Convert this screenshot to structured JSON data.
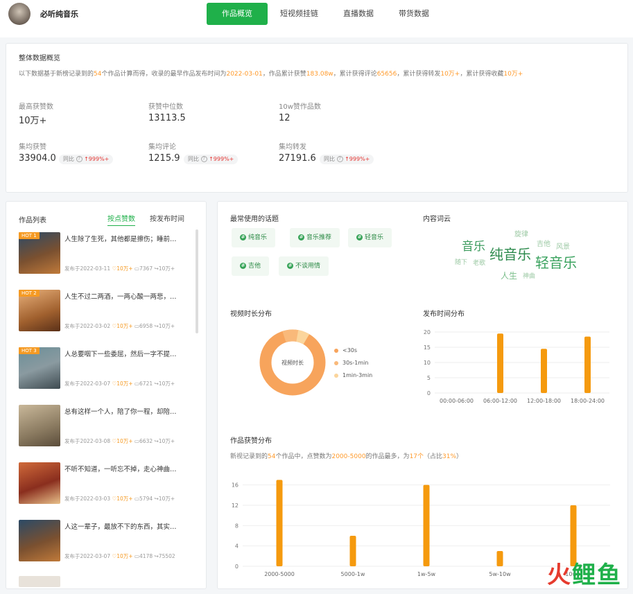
{
  "header": {
    "channel_name": "必听纯音乐",
    "tabs": [
      {
        "label": "作品概览",
        "active": true
      },
      {
        "label": "短视频挂链",
        "active": false
      },
      {
        "label": "直播数据",
        "active": false
      },
      {
        "label": "带货数据",
        "active": false
      }
    ]
  },
  "overview": {
    "title": "整体数据概览",
    "desc": {
      "p1": "以下数据基于新榜记录到的",
      "count": "54",
      "p2": "个作品计算而得，收录的最早作品发布时间为",
      "date": "2022-03-01",
      "p3": "，作品累计获赞",
      "likes": "183.08w",
      "p4": "，累计获得评论",
      "comments": "65656",
      "p5": "，累计获得转发",
      "shares": "10万+",
      "p6": "，累计获得收藏",
      "favs": "10万+"
    },
    "metrics": [
      {
        "label": "最高获赞数",
        "value": "10万+"
      },
      {
        "label": "获赞中位数",
        "value": "13113.5"
      },
      {
        "label": "10w赞作品数",
        "value": "12"
      },
      {
        "label": "集均获赞",
        "value": "33904.0",
        "compare": "同比",
        "change": "999%+"
      },
      {
        "label": "集均评论",
        "value": "1215.9",
        "compare": "同比",
        "change": "999%+"
      },
      {
        "label": "集均转发",
        "value": "27191.6",
        "compare": "同比",
        "change": "999%+"
      }
    ]
  },
  "works": {
    "title": "作品列表",
    "sort_likes": "按点赞数",
    "sort_time": "按发布时间",
    "items": [
      {
        "hot": "HOT 1",
        "title": "人生除了生死，其他都是擦伤；睡前…",
        "date": "发布于2022-03-11",
        "likes": "10万+",
        "comments": "7367",
        "shares": "10万+"
      },
      {
        "hot": "HOT 2",
        "title": "人生不过二两酒，一两心酸一两悲，…",
        "date": "发布于2022-03-02",
        "likes": "10万+",
        "comments": "6958",
        "shares": "10万+"
      },
      {
        "hot": "HOT 3",
        "title": "人总要咽下一些委屈，然后一字不提…",
        "date": "发布于2022-03-07",
        "likes": "10万+",
        "comments": "6721",
        "shares": "10万+"
      },
      {
        "hot": "",
        "title": "总有这样一个人，陪了你一程，却陪…",
        "date": "发布于2022-03-08",
        "likes": "10万+",
        "comments": "6632",
        "shares": "10万+"
      },
      {
        "hot": "",
        "title": "不听不知道，一听忘不掉，走心神曲…",
        "date": "发布于2022-03-03",
        "likes": "10万+",
        "comments": "5794",
        "shares": "10万+"
      },
      {
        "hot": "",
        "title": "人这一辈子，最放不下的东西，其实…",
        "date": "发布于2022-03-07",
        "likes": "10万+",
        "comments": "4178",
        "shares": "75502"
      }
    ]
  },
  "topics": {
    "title": "最常使用的话题",
    "items": [
      "纯音乐",
      "音乐推荐",
      "轻音乐",
      "吉他",
      "不谈用情"
    ]
  },
  "wordcloud": {
    "title": "内容词云",
    "words": [
      "音乐",
      "纯音乐",
      "轻音乐",
      "旋律",
      "吉他",
      "风景",
      "随下",
      "老歌",
      "人生",
      "神曲"
    ]
  },
  "duration": {
    "title": "视频时长分布",
    "center": "视频时长",
    "legend": [
      "<30s",
      "30s-1min",
      "1min-3min"
    ],
    "colors": [
      "#f7a45c",
      "#f9b97a",
      "#fbd59c"
    ]
  },
  "chart_data": [
    {
      "type": "bar",
      "title": "发布时间分布",
      "categories": [
        "00:00-06:00",
        "06:00-12:00",
        "12:00-18:00",
        "18:00-24:00"
      ],
      "values": [
        0,
        19.5,
        14.5,
        18.5
      ],
      "ylim": [
        0,
        20
      ],
      "yticks": [
        0,
        5,
        10,
        15,
        20
      ],
      "color": "#f59a0e"
    },
    {
      "type": "bar",
      "title": "作品获赞分布",
      "categories": [
        "2000-5000",
        "5000-1w",
        "1w-5w",
        "5w-10w",
        "10w+"
      ],
      "values": [
        17,
        6,
        16,
        3,
        12
      ],
      "ylim": [
        0,
        18
      ],
      "yticks": [
        0,
        4,
        8,
        12,
        16
      ],
      "color": "#f59a0e"
    }
  ],
  "likes_dist": {
    "p1": "新视记录到的",
    "count": "54",
    "p2": "个作品中，点赞数为",
    "range": "2000-5000",
    "p3": "的作品最多，为",
    "num": "17个",
    "p4": "（占比",
    "pct": "31%",
    "p5": "）"
  },
  "watermark": {
    "a": "火",
    "b": "鲤鱼"
  }
}
